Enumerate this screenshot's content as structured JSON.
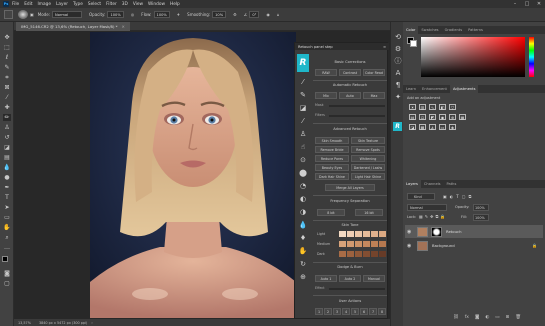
{
  "menubar": {
    "items": [
      "File",
      "Edit",
      "Image",
      "Layer",
      "Type",
      "Select",
      "Filter",
      "3D",
      "View",
      "Window",
      "Help"
    ],
    "logo": "Ps"
  },
  "options_bar": {
    "mode_label": "Mode:",
    "mode_value": "Normal",
    "opacity_label": "Opacity:",
    "opacity_value": "100%",
    "flow_label": "Flow:",
    "flow_value": "100%",
    "smoothing_label": "Smoothing:",
    "smoothing_value": "10%",
    "angle_value": "0°"
  },
  "document": {
    "tab_title": "IMG_5146.CR2 @ 13,6% (Retouch, Layer Mask/8) *",
    "status_zoom": "13,57%",
    "status_info": "3840 px x 5472 px (300 ppi)"
  },
  "retouch_panel": {
    "title": "Retouch panel step",
    "logo": "R",
    "sections": {
      "basic": "Basic Corrections",
      "auto": "Automatic Retouch",
      "advanced": "Advanced Retouch",
      "frequency": "Frequency Separation",
      "skin_tone": "Skin Tone",
      "dodge": "Dodge & Burn",
      "actions": "User Actions"
    },
    "basic_buttons": [
      "RAW",
      "Contrast",
      "Color Read"
    ],
    "auto_buttons": [
      "Mix",
      "Auto",
      "Max"
    ],
    "sliders": [
      "Mask",
      "Filters"
    ],
    "advanced_buttons": [
      [
        "Skin Smooth",
        "Skin Texture"
      ],
      [
        "Remove Bride",
        "Remove Spots"
      ],
      [
        "Reduce Pores",
        "Whitening"
      ],
      [
        "Beauty Eyes",
        "Darkened / Lashs"
      ],
      [
        "Dark Hair Shine",
        "Light Hair Shine"
      ]
    ],
    "merge_label": "Merge All Layers",
    "freq_buttons": [
      "8 bit",
      "16 bit"
    ],
    "skin_rows": [
      "Light",
      "Medium",
      "Dark"
    ],
    "dodge_buttons": [
      "Auto 1",
      "Auto 2",
      "Manual"
    ],
    "dodge_slider": "Effect",
    "user_actions": [
      "1",
      "2",
      "3",
      "4",
      "5",
      "6",
      "7",
      "8"
    ]
  },
  "panels": {
    "color_tabs": [
      "Color",
      "Swatches",
      "Gradients",
      "Patterns"
    ],
    "adj_tabs": [
      "Learn",
      "Enhancement",
      "Adjustments"
    ],
    "adj_title": "Add an adjustment",
    "layers_tabs": [
      "Layers",
      "Channels",
      "Paths"
    ],
    "kind_label": "Kind",
    "blend_mode": "Normal",
    "opacity_label": "Opacity:",
    "opacity_value": "100%",
    "lock_label": "Lock:",
    "fill_label": "Fill:",
    "fill_value": "100%",
    "layers": [
      {
        "name": "Retouch"
      },
      {
        "name": "Background"
      }
    ]
  },
  "colors": {
    "accent": "#1fb7c9",
    "foreground": "#000000",
    "background": "#ffffff",
    "picker_hue": "#ff0000"
  }
}
